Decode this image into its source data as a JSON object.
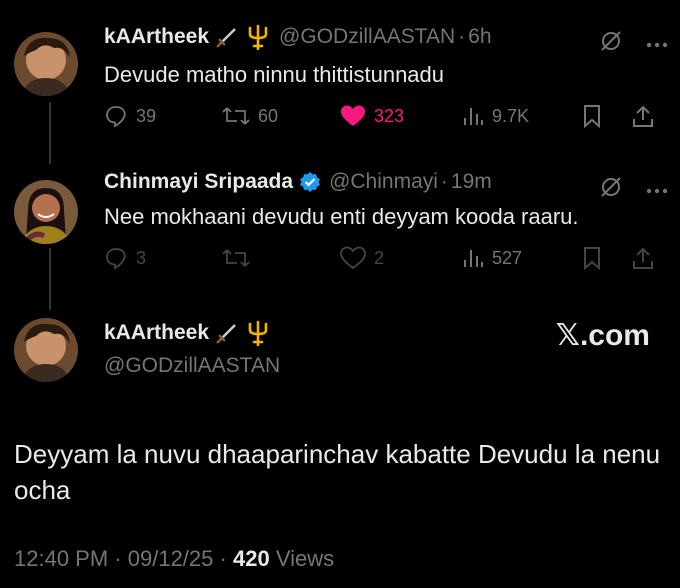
{
  "tweet1": {
    "name": "kAArtheek",
    "emojis": [
      "dagger-emoji",
      "trident-emoji"
    ],
    "handle": "@GODzillAASTAN",
    "time": "6h",
    "text": "Devude matho ninnu thittistunnadu",
    "replies": "39",
    "reposts": "60",
    "likes": "323",
    "views": "9.7K"
  },
  "tweet2": {
    "name": "Chinmayi Sripaada",
    "handle": "@Chinmayi",
    "time": "19m",
    "text": "Nee mokhaani devudu enti deyyam kooda raaru.",
    "replies": "3",
    "reposts": "",
    "likes": "2",
    "views": "527"
  },
  "main": {
    "name": "kAArtheek",
    "handle": "@GODzillAASTAN",
    "site": "𝕏.com",
    "text": "Deyyam la nuvu dhaaparinchav kabatte Devudu la nenu ocha",
    "time": "12:40 PM",
    "date": "09/12/25",
    "views_count": "420",
    "views_label": "Views"
  },
  "colors": {
    "background": "#000000",
    "text": "#e7e9ea",
    "muted": "#71767b",
    "like": "#f91880",
    "verified": "#1d9bf0"
  }
}
